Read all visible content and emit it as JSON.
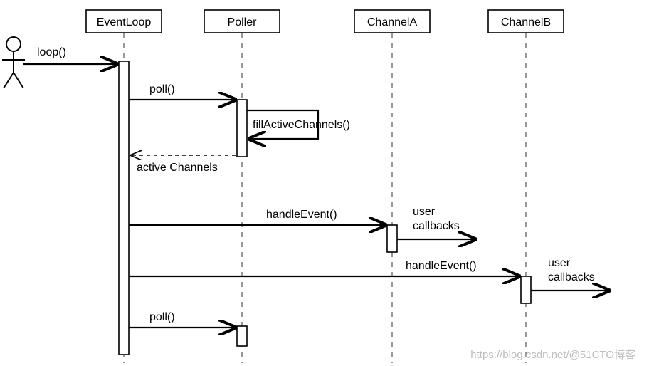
{
  "lifelines": {
    "eventloop": "EventLoop",
    "poller": "Poller",
    "channelA": "ChannelA",
    "channelB": "ChannelB"
  },
  "messages": {
    "loop": "loop()",
    "poll1": "poll()",
    "fillActive": "fillActiveChannels()",
    "activeChannels": "active Channels",
    "handleEventA": "handleEvent()",
    "userCallbacksA_line1": "user",
    "userCallbacksA_line2": "callbacks",
    "handleEventB": "handleEvent()",
    "userCallbacksB_line1": "user",
    "userCallbacksB_line2": "callbacks",
    "poll2": "poll()"
  },
  "watermark": "https://blog.csdn.net/@51CTO博客"
}
